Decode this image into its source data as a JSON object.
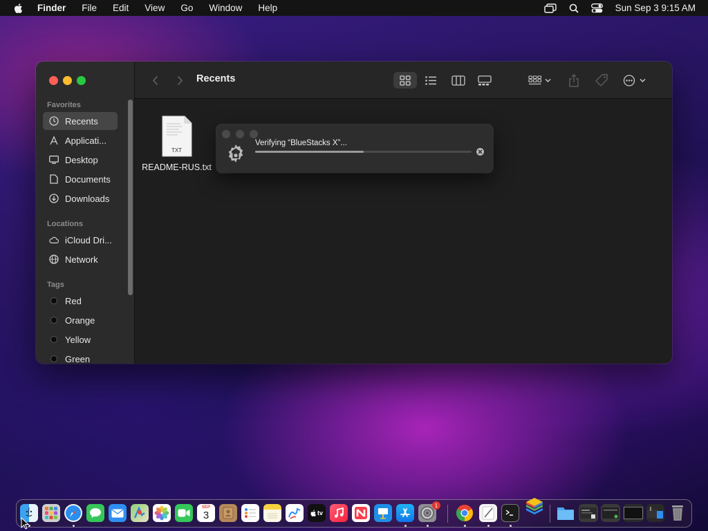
{
  "menubar": {
    "app_name": "Finder",
    "menus": [
      "File",
      "Edit",
      "View",
      "Go",
      "Window",
      "Help"
    ],
    "clock": "Sun Sep 3  9:15 AM"
  },
  "window": {
    "title": "Recents",
    "sidebar": {
      "favorites_title": "Favorites",
      "favorites": [
        {
          "label": "Recents",
          "icon": "clock-icon",
          "selected": true
        },
        {
          "label": "Applicati...",
          "icon": "applications-icon"
        },
        {
          "label": "Desktop",
          "icon": "desktop-icon"
        },
        {
          "label": "Documents",
          "icon": "document-icon"
        },
        {
          "label": "Downloads",
          "icon": "download-icon"
        }
      ],
      "locations_title": "Locations",
      "locations": [
        {
          "label": "iCloud Dri...",
          "icon": "cloud-icon"
        },
        {
          "label": "Network",
          "icon": "globe-icon"
        }
      ],
      "tags_title": "Tags",
      "tags": [
        {
          "label": "Red"
        },
        {
          "label": "Orange"
        },
        {
          "label": "Yellow"
        },
        {
          "label": "Green"
        }
      ]
    },
    "files": [
      {
        "name": "README-RUS.txt",
        "type_label": "TXT"
      }
    ]
  },
  "verify_dialog": {
    "text": "Verifying “BlueStacks X”...",
    "progress": 0.5
  },
  "dock": {
    "apps": [
      "finder",
      "launchpad",
      "safari",
      "messages",
      "mail",
      "maps",
      "photos",
      "facetime",
      "calendar",
      "contacts",
      "reminders",
      "notes",
      "freeform",
      "tv",
      "music",
      "news",
      "keynote",
      "app-store",
      "system-settings",
      "chrome",
      "textedit",
      "terminal",
      "bluestacks"
    ],
    "calendar_month": "SEP",
    "calendar_day": "3",
    "tv_label": "tv",
    "settings_badge": "1"
  },
  "colors": {
    "close": "#fe5f57",
    "minimize": "#febc2e",
    "zoom": "#28c840"
  }
}
